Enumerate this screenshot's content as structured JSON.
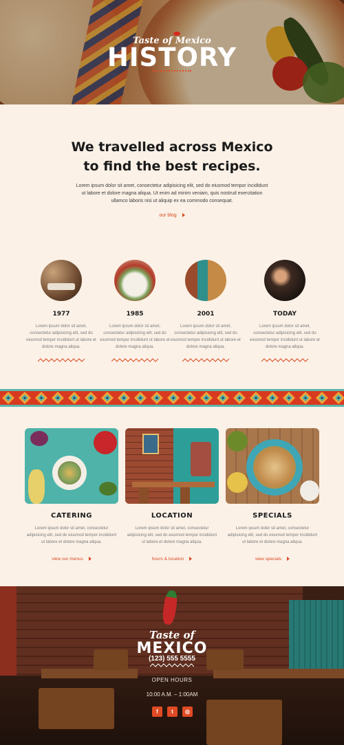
{
  "hero": {
    "brand_script": "Taste of Mexico",
    "title": "HISTORY"
  },
  "intro": {
    "heading_line1": "We travelled across Mexico",
    "heading_line2": "to find the best recipes.",
    "paragraph": "Lorem ipsum dolor sit amet, consectetur adipisicing elit, sed do eiusmod tempor incididunt ut labore et dolore magna aliqua. Ut enim ad minim veniam, quis nostrud exercitation ullamco laboris nisi ut aliquip ex ea commodo consequat.",
    "link_label": "our blog"
  },
  "timeline": [
    {
      "year": "1977",
      "text": "Lorem ipsum dolor sit amet, consectetur adipisicing elit, sed do eiusmod tempor incididunt ut labore et dolore magna aliqua."
    },
    {
      "year": "1985",
      "text": "Lorem ipsum dolor sit amet, consectetur adipisicing elit, sed do eiusmod tempor incididunt ut labore et dolore magna aliqua."
    },
    {
      "year": "2001",
      "text": "Lorem ipsum dolor sit amet, consectetur adipisicing elit, sed do eiusmod tempor incididunt ut labore et dolore magna aliqua."
    },
    {
      "year": "TODAY",
      "text": "Lorem ipsum dolor sit amet, consectetur adipisicing elit, sed do eiusmod tempor incididunt ut labore et dolore magna aliqua."
    }
  ],
  "cards": [
    {
      "title": "CATERING",
      "text": "Lorem ipsum dolor sit amet, consectetur adipisicing elit, sed do eiusmod tempor incididunt ut labore et dolore magna aliqua.",
      "link": "view our menus"
    },
    {
      "title": "LOCATION",
      "text": "Lorem ipsum dolor sit amet, consectetur adipisicing elit, sed do eiusmod tempor incididunt ut labore et dolore magna aliqua.",
      "link": "hours & location"
    },
    {
      "title": "SPECIALS",
      "text": "Lorem ipsum dolor sit amet, consectetur adipisicing elit, sed do eiusmod tempor incididunt ut labore et dolore magna aliqua.",
      "link": "view specials"
    }
  ],
  "footer": {
    "brand_script": "Taste of",
    "brand_main": "MEXICO",
    "phone": "(123) 555 5555",
    "hours_title": "OPEN HOURS",
    "hours": "10:00 A.M. – 1:00AM",
    "social": [
      {
        "icon": "facebook-icon",
        "glyph": "f"
      },
      {
        "icon": "twitter-icon",
        "glyph": "t"
      },
      {
        "icon": "instagram-icon",
        "glyph": "◎"
      }
    ]
  },
  "colors": {
    "accent": "#d84a22",
    "background": "#fbf1e7",
    "teal": "#5bb8b0",
    "text_dark": "#1a1a1a"
  }
}
